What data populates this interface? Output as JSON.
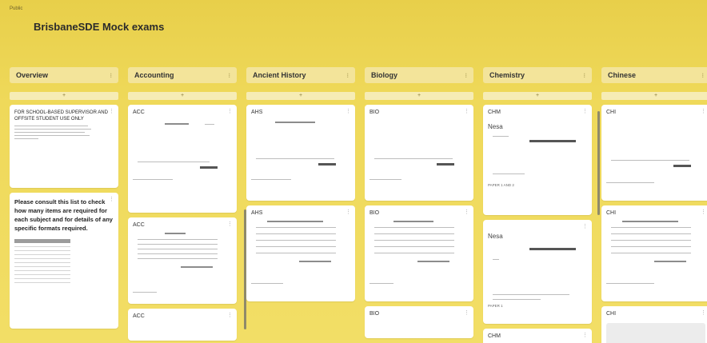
{
  "app": {
    "title": "Public"
  },
  "board": {
    "breadcrumb": "",
    "title": "BrisbaneSDE Mock exams",
    "subtitle": ""
  },
  "lists": [
    {
      "name": "Overview",
      "add": "+",
      "cards": [
        {
          "title": "FOR SCHOOL-BASED SUPERVISOR AND OFFSITE STUDENT USE ONLY",
          "desc": ""
        },
        {
          "title": "Please consult this list to check how many items are required for each subject and for details of any specific formats required.",
          "desc": ""
        }
      ]
    },
    {
      "name": "Accounting",
      "add": "+",
      "cards": [
        {
          "code": "ACC"
        },
        {
          "code": "ACC"
        },
        {
          "code": "ACC"
        }
      ]
    },
    {
      "name": "Ancient History",
      "add": "+",
      "cards": [
        {
          "code": "AHS"
        },
        {
          "code": "AHS"
        }
      ]
    },
    {
      "name": "Biology",
      "add": "+",
      "cards": [
        {
          "code": "BIO"
        },
        {
          "code": "BIO"
        },
        {
          "code": "BIO"
        }
      ]
    },
    {
      "name": "Chemistry",
      "add": "+",
      "cards": [
        {
          "code": "CHM",
          "logo": "Nesa",
          "foot": "PAPER 1 AND 2"
        },
        {
          "code": "",
          "logo": "Nesa",
          "foot": "PAPER 1"
        },
        {
          "code": "CHM"
        }
      ]
    },
    {
      "name": "Chinese",
      "add": "+",
      "cards": [
        {
          "code": "CHI"
        },
        {
          "code": "CHI"
        },
        {
          "code": "CHI"
        }
      ]
    }
  ],
  "icons": {
    "list_menu": "more-icon",
    "card_menu": "more-vertical-icon"
  },
  "colors": {
    "board_bg": "#efd95a",
    "list_header": "#f3e49a",
    "card": "#ffffff"
  }
}
